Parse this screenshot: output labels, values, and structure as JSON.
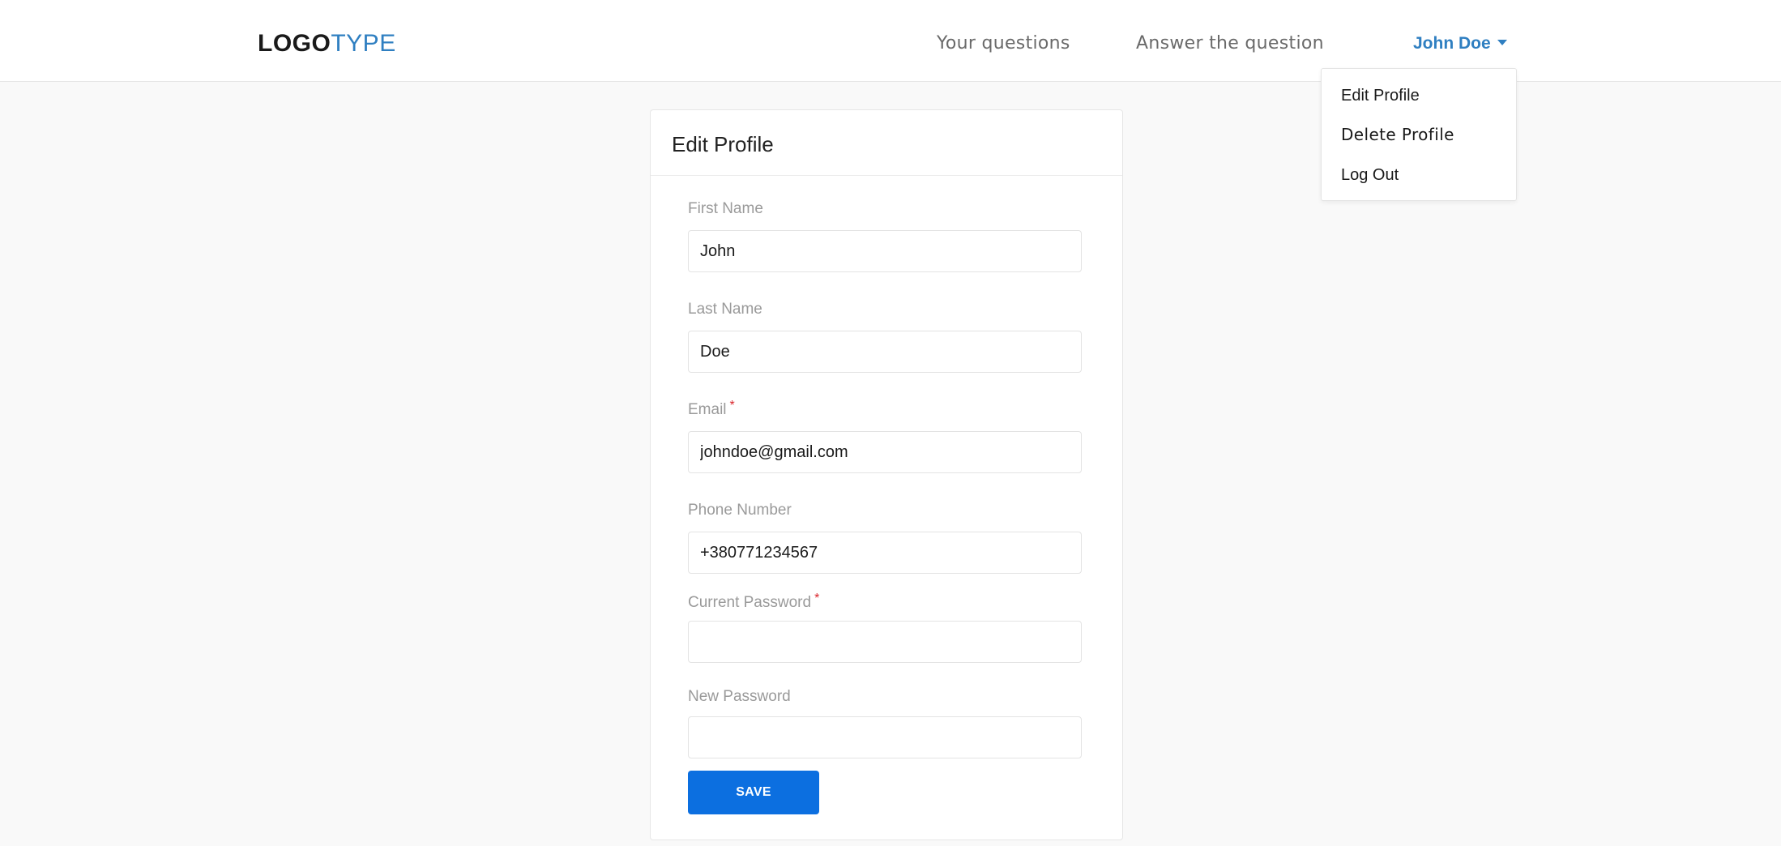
{
  "header": {
    "logo_bold": "LOGO",
    "logo_light": "TYPE",
    "nav": {
      "your_questions": "Your questions",
      "answer_question": "Answer the question"
    },
    "user_name": "John Doe",
    "dropdown": {
      "edit_profile": "Edit Profile",
      "delete_profile": "Delete Profile",
      "log_out": "Log Out"
    }
  },
  "form": {
    "title": "Edit Profile",
    "required_mark": "*",
    "fields": {
      "first_name": {
        "label": "First Name",
        "value": "John"
      },
      "last_name": {
        "label": "Last Name",
        "value": "Doe"
      },
      "email": {
        "label": "Email",
        "value": "johndoe@gmail.com"
      },
      "phone": {
        "label": "Phone Number",
        "value": "+380771234567"
      },
      "current_password": {
        "label": "Current Password",
        "value": ""
      },
      "new_password": {
        "label": "New Password",
        "value": ""
      }
    },
    "save_label": "SAVE"
  },
  "colors": {
    "accent": "#2f7fc1",
    "button": "#0c6fe0",
    "required": "#d9262c",
    "background": "#f9f9f9"
  }
}
